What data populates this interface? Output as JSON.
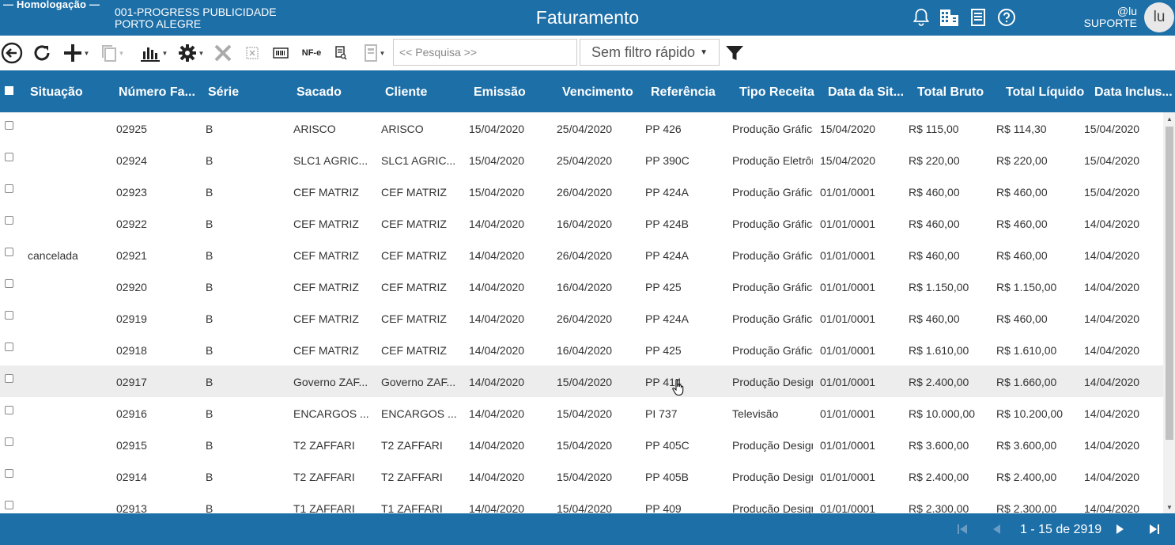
{
  "header": {
    "env_label": "— Homologação —",
    "company_line1": "001-PROGRESS PUBLICIDADE",
    "company_line2": "PORTO ALEGRE",
    "title": "Faturamento",
    "user_handle": "@lu",
    "user_role": "SUPORTE",
    "avatar_initials": "lu",
    "icons": [
      "bell-icon",
      "building-icon",
      "report-icon",
      "help-icon"
    ]
  },
  "toolbar": {
    "nfe_label": "NF-e",
    "search_placeholder": "<< Pesquisa >>",
    "quick_filter": "Sem filtro rápido"
  },
  "table": {
    "columns": [
      "Situação",
      "Número Fa...",
      "Série",
      "Sacado",
      "Cliente",
      "Emissão",
      "Vencimento",
      "Referência",
      "Tipo Receita",
      "Data da Sit...",
      "Total Bruto",
      "Total Líquido",
      "Data Inclus..."
    ],
    "rows": [
      [
        "",
        "02925",
        "B",
        "ARISCO",
        "ARISCO",
        "15/04/2020",
        "25/04/2020",
        "PP 426",
        "Produção Gráfica",
        "15/04/2020",
        "R$ 115,00",
        "R$ 114,30",
        "15/04/2020"
      ],
      [
        "",
        "02924",
        "B",
        "SLC1 AGRIC...",
        "SLC1 AGRIC...",
        "15/04/2020",
        "25/04/2020",
        "PP 390C",
        "Produção Eletrônica",
        "15/04/2020",
        "R$ 220,00",
        "R$ 220,00",
        "15/04/2020"
      ],
      [
        "",
        "02923",
        "B",
        "CEF MATRIZ",
        "CEF MATRIZ",
        "15/04/2020",
        "26/04/2020",
        "PP 424A",
        "Produção Gráfica",
        "01/01/0001",
        "R$ 460,00",
        "R$ 460,00",
        "15/04/2020"
      ],
      [
        "",
        "02922",
        "B",
        "CEF MATRIZ",
        "CEF MATRIZ",
        "14/04/2020",
        "16/04/2020",
        "PP 424B",
        "Produção Gráfica",
        "01/01/0001",
        "R$ 460,00",
        "R$ 460,00",
        "14/04/2020"
      ],
      [
        "cancelada",
        "02921",
        "B",
        "CEF MATRIZ",
        "CEF MATRIZ",
        "14/04/2020",
        "26/04/2020",
        "PP 424A",
        "Produção Gráfica",
        "01/01/0001",
        "R$ 460,00",
        "R$ 460,00",
        "14/04/2020"
      ],
      [
        "",
        "02920",
        "B",
        "CEF MATRIZ",
        "CEF MATRIZ",
        "14/04/2020",
        "16/04/2020",
        "PP 425",
        "Produção Gráfica",
        "01/01/0001",
        "R$ 1.150,00",
        "R$ 1.150,00",
        "14/04/2020"
      ],
      [
        "",
        "02919",
        "B",
        "CEF MATRIZ",
        "CEF MATRIZ",
        "14/04/2020",
        "26/04/2020",
        "PP 424A",
        "Produção Gráfica",
        "01/01/0001",
        "R$ 460,00",
        "R$ 460,00",
        "14/04/2020"
      ],
      [
        "",
        "02918",
        "B",
        "CEF MATRIZ",
        "CEF MATRIZ",
        "14/04/2020",
        "16/04/2020",
        "PP 425",
        "Produção Gráfica",
        "01/01/0001",
        "R$ 1.610,00",
        "R$ 1.610,00",
        "14/04/2020"
      ],
      [
        "",
        "02917",
        "B",
        "Governo ZAF...",
        "Governo ZAF...",
        "14/04/2020",
        "15/04/2020",
        "PP 414",
        "Produção Design",
        "01/01/0001",
        "R$ 2.400,00",
        "R$ 1.660,00",
        "14/04/2020"
      ],
      [
        "",
        "02916",
        "B",
        "ENCARGOS ...",
        "ENCARGOS ...",
        "14/04/2020",
        "15/04/2020",
        "PI 737",
        "Televisão",
        "01/01/0001",
        "R$ 10.000,00",
        "R$ 10.200,00",
        "14/04/2020"
      ],
      [
        "",
        "02915",
        "B",
        "T2 ZAFFARI",
        "T2 ZAFFARI",
        "14/04/2020",
        "15/04/2020",
        "PP 405C",
        "Produção Design",
        "01/01/0001",
        "R$ 3.600,00",
        "R$ 3.600,00",
        "14/04/2020"
      ],
      [
        "",
        "02914",
        "B",
        "T2 ZAFFARI",
        "T2 ZAFFARI",
        "14/04/2020",
        "15/04/2020",
        "PP 405B",
        "Produção Design",
        "01/01/0001",
        "R$ 2.400,00",
        "R$ 2.400,00",
        "14/04/2020"
      ],
      [
        "",
        "02913",
        "B",
        "T1 ZAFFARI",
        "T1 ZAFFARI",
        "14/04/2020",
        "15/04/2020",
        "PP 409",
        "Produção Design",
        "01/01/0001",
        "R$ 2.300,00",
        "R$ 2.300,00",
        "14/04/2020"
      ]
    ]
  },
  "footer": {
    "page_info": "1 - 15 de 2919"
  },
  "colors": {
    "primary": "#1d6fa8",
    "row_hover": "#ededed"
  }
}
